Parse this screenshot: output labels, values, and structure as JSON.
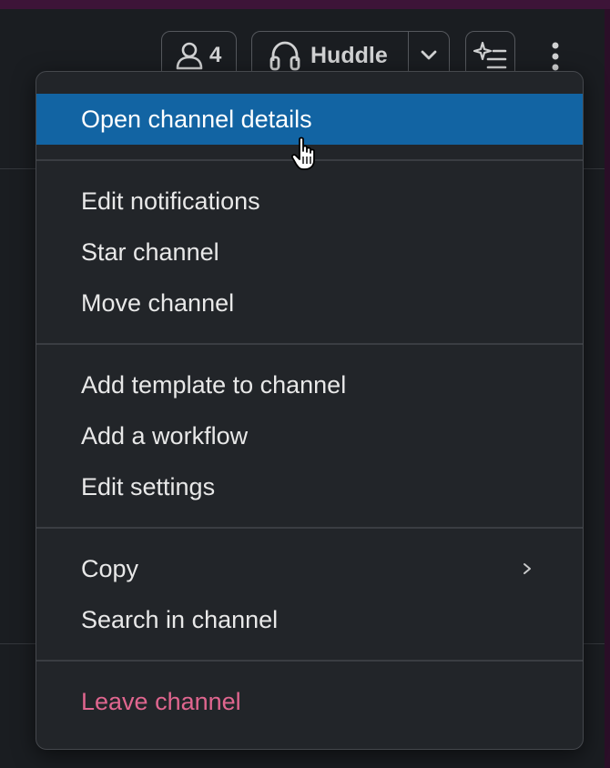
{
  "header": {
    "members": {
      "icon": "person-icon",
      "count": "4"
    },
    "huddle": {
      "icon": "headphones-icon",
      "label": "Huddle",
      "caret_icon": "chevron-down-icon"
    },
    "ai_button": {
      "icon": "sparkle-list-icon"
    },
    "more_button": {
      "icon": "vertical-ellipsis-icon"
    }
  },
  "menu": {
    "open_details": "Open channel details",
    "edit_notifications": "Edit notifications",
    "star_channel": "Star channel",
    "move_channel": "Move channel",
    "add_template": "Add template to channel",
    "add_workflow": "Add a workflow",
    "edit_settings": "Edit settings",
    "copy": "Copy",
    "search_in_channel": "Search in channel",
    "leave_channel": "Leave channel"
  },
  "colors": {
    "highlight": "#1264a3",
    "danger": "#e0668f",
    "menu_bg": "#222529",
    "app_bg": "#1a1d21",
    "workspace_accent": "#3d1438"
  },
  "cursor": {
    "icon": "hand-pointer-icon"
  }
}
